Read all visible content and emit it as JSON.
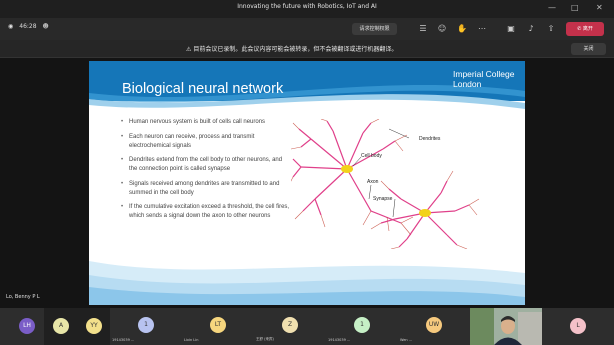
{
  "window": {
    "title": "Innovating the future with Robotics, IoT and AI"
  },
  "toolbar": {
    "timer": "46:28",
    "share_pill": "请求控制权限",
    "leave_label": "离开"
  },
  "banner": {
    "text": "目前会议已录制。此会议内容可能会被转录，但不会被翻译或进行机器翻译。",
    "close_label": "关闭"
  },
  "slide": {
    "title": "Biological neural network",
    "brand_line1": "Imperial College",
    "brand_line2": "London",
    "bullets": [
      "Human nervous system is built of cells call neurons",
      "Each neuron can receive, process and transmit electrochemical signals",
      "Dendrites extend from the cell body to other neurons, and the connection point is called synapse",
      "Signals received among dendrites are transmitted to and summed in the cell body",
      "If the cumulative excitation exceed a threshold, the cell fires, which sends a signal down the axon to other neurons"
    ],
    "labels": {
      "dendrites": "Dendrites",
      "cell_body": "Cell body",
      "axon": "Axon",
      "synapse": "Synapse"
    }
  },
  "speaker": {
    "name": "Lo, Benny P L"
  },
  "participants": [
    {
      "initials": "LH",
      "name": "",
      "color": "#7a5dc7"
    },
    {
      "initials": "A",
      "name": "",
      "color": "#e8e6a8"
    },
    {
      "initials": "YY",
      "name": "",
      "color": "#f3e08b"
    },
    {
      "initials": "1",
      "name": "19143039 ...",
      "color": "#b8c3f0"
    },
    {
      "initials": "LT",
      "name": "Lixin Lin",
      "color": "#f6d67e"
    },
    {
      "initials": "Z",
      "name": "王舒 (来宾)",
      "color": "#f0e0b0"
    },
    {
      "initials": "1",
      "name": "19143039 ...",
      "color": "#c6f0c6"
    },
    {
      "initials": "UW",
      "name": "Wen ...",
      "color": "#f6c97e"
    },
    {
      "initials": "L",
      "name": "",
      "color": "#f4c1c9"
    }
  ]
}
